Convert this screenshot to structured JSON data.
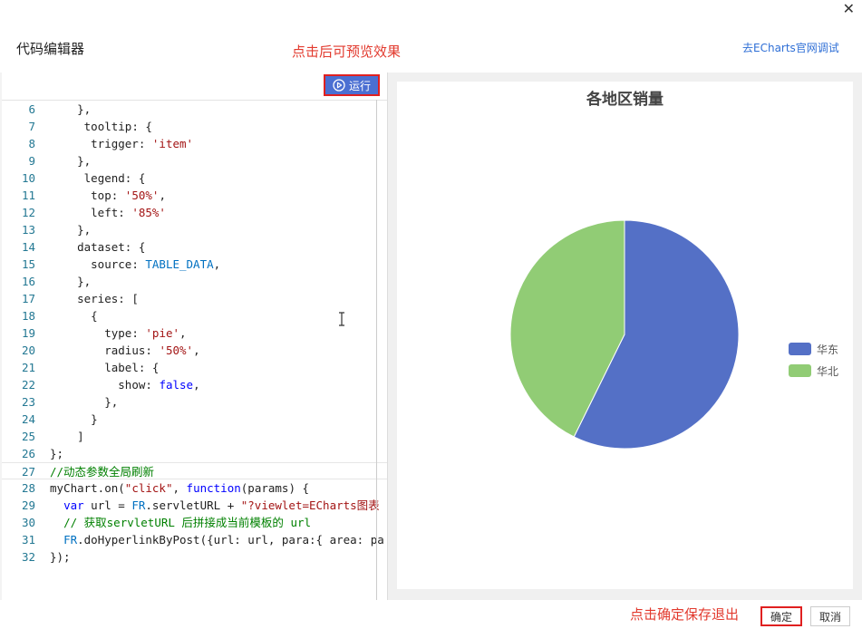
{
  "header": {
    "title": "代码编辑器",
    "preview_hint": "点击后可预览效果",
    "echarts_link": "去ECharts官网调试",
    "close": "✕"
  },
  "editor": {
    "run_label": "运行",
    "lines": [
      {
        "n": "6",
        "html": "    },"
      },
      {
        "n": "7",
        "html": "     <k>tooltip</k>: {"
      },
      {
        "n": "8",
        "html": "      <k>trigger</k>: <s>'item'</s>"
      },
      {
        "n": "9",
        "html": "    },"
      },
      {
        "n": "10",
        "html": "     <k>legend</k>: {"
      },
      {
        "n": "11",
        "html": "      <k>top</k>: <s>'50%'</s>,"
      },
      {
        "n": "12",
        "html": "      <k>left</k>: <s>'85%'</s>"
      },
      {
        "n": "13",
        "html": "    },"
      },
      {
        "n": "14",
        "html": "    <k>dataset</k>: {"
      },
      {
        "n": "15",
        "html": "      <k>source</k>: <c>TABLE_DATA</c>,"
      },
      {
        "n": "16",
        "html": "    },"
      },
      {
        "n": "17",
        "html": "    <k>series</k>: ["
      },
      {
        "n": "18",
        "html": "      {"
      },
      {
        "n": "19",
        "html": "        <k>type</k>: <s>'pie'</s>,"
      },
      {
        "n": "20",
        "html": "        <k>radius</k>: <s>'50%'</s>,"
      },
      {
        "n": "21",
        "html": "        <k>label</k>: {"
      },
      {
        "n": "22",
        "html": "          <k>show</k>: <b>false</b>,"
      },
      {
        "n": "23",
        "html": "        },"
      },
      {
        "n": "24",
        "html": "      }"
      },
      {
        "n": "25",
        "html": "    ]"
      },
      {
        "n": "26",
        "html": "};"
      },
      {
        "n": "27",
        "html": "<g>//动态参数全局刷新</g>"
      },
      {
        "n": "28",
        "html": "myChart.on(<s>\"click\"</s>, <b>function</b>(params) {"
      },
      {
        "n": "29",
        "html": "  <b>var</b> url = <c>FR</c>.servletURL + <s>\"?viewlet=ECharts图表</s>"
      },
      {
        "n": "30",
        "html": "  <g>// 获取servletURL 后拼接成当前模板的 url</g>"
      },
      {
        "n": "31",
        "html": "  <c>FR</c>.doHyperlinkByPost({url: url, para:{ area: pa"
      },
      {
        "n": "32",
        "html": "});"
      }
    ]
  },
  "chart_data": {
    "type": "pie",
    "title": "各地区销量",
    "series": [
      {
        "name": "华东",
        "value": 57.3,
        "color": "#5470c6"
      },
      {
        "name": "华北",
        "value": 42.7,
        "color": "#91cc75"
      }
    ],
    "legend": "right"
  },
  "footer": {
    "save_hint": "点击确定保存退出",
    "ok_label": "确定",
    "cancel_label": "取消"
  }
}
